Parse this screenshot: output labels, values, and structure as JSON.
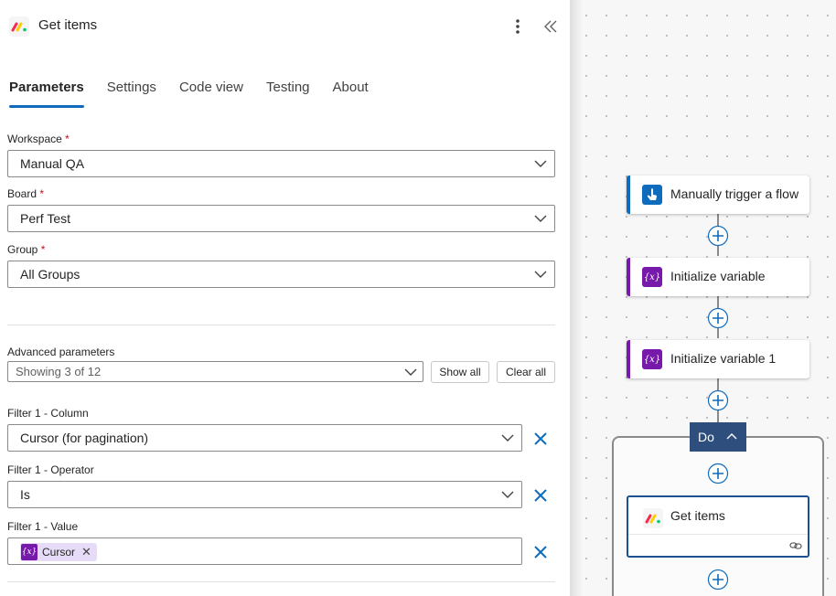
{
  "panel": {
    "title": "Get items",
    "tabs": [
      {
        "label": "Parameters",
        "active": true
      },
      {
        "label": "Settings",
        "active": false
      },
      {
        "label": "Code view",
        "active": false
      },
      {
        "label": "Testing",
        "active": false
      },
      {
        "label": "About",
        "active": false
      }
    ],
    "fields": {
      "workspace": {
        "label": "Workspace",
        "required_mark": "*",
        "value": "Manual QA"
      },
      "board": {
        "label": "Board",
        "required_mark": "*",
        "value": "Perf Test"
      },
      "group": {
        "label": "Group",
        "required_mark": "*",
        "value": "All Groups"
      }
    },
    "advanced": {
      "label": "Advanced parameters",
      "summary": "Showing 3 of 12",
      "show_all": "Show all",
      "clear_all": "Clear all"
    },
    "filters": {
      "column": {
        "label": "Filter 1 - Column",
        "value": "Cursor (for pagination)"
      },
      "operator": {
        "label": "Filter 1 - Operator",
        "value": "Is"
      },
      "value": {
        "label": "Filter 1 - Value",
        "token_label": "Cursor",
        "token_icon": "{x}"
      }
    }
  },
  "canvas": {
    "nodes": [
      {
        "label": "Manually trigger a flow",
        "icon": "manual-trigger-icon",
        "accent": "#0f6cbd"
      },
      {
        "label": "Initialize variable",
        "icon": "variable-icon",
        "accent": "#7719aa"
      },
      {
        "label": "Initialize variable 1",
        "icon": "variable-icon",
        "accent": "#7719aa"
      }
    ],
    "scope_label": "Do",
    "selected_node": {
      "label": "Get items",
      "icon": "monday-logo-icon"
    },
    "variable_icon_text": "{x}"
  },
  "colors": {
    "accent_blue": "#0f6cbd",
    "variable_purple": "#7719aa",
    "scope_header": "#2e4e7e",
    "required_red": "#c50f1f"
  }
}
